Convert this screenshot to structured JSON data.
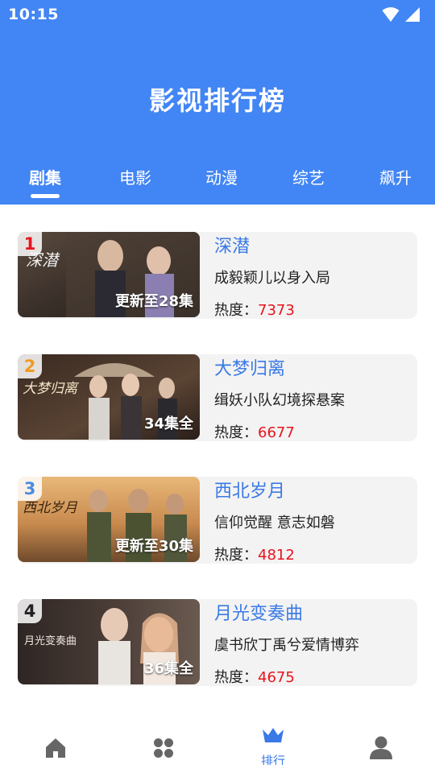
{
  "status_bar": {
    "time": "10:15"
  },
  "header": {
    "title": "影视排行榜"
  },
  "tabs": [
    {
      "label": "剧集",
      "active": true
    },
    {
      "label": "电影",
      "active": false
    },
    {
      "label": "动漫",
      "active": false
    },
    {
      "label": "综艺",
      "active": false
    },
    {
      "label": "飙升",
      "active": false
    }
  ],
  "items": [
    {
      "rank": "1",
      "rank_color": "#e8141c",
      "title": "深潜",
      "thumb_text": "深潜",
      "episodes": "更新至28集",
      "desc": "成毅颖儿以身入局",
      "heat_label": "热度：",
      "heat_value": "7373"
    },
    {
      "rank": "2",
      "rank_color": "#f29a1e",
      "title": "大梦归离",
      "thumb_text": "大梦归离",
      "episodes": "34集全",
      "desc": "缉妖小队幻境探悬案",
      "heat_label": "热度：",
      "heat_value": "6677"
    },
    {
      "rank": "3",
      "rank_color": "#4a8be0",
      "title": "西北岁月",
      "thumb_text": "西北岁月",
      "episodes": "更新至30集",
      "desc": "信仰觉醒 意志如磐",
      "heat_label": "热度：",
      "heat_value": "4812"
    },
    {
      "rank": "4",
      "rank_color": "#222222",
      "title": "月光变奏曲",
      "thumb_text": "月光变奏曲",
      "episodes": "36集全",
      "desc": "虞书欣丁禹兮爱情博弈",
      "heat_label": "热度：",
      "heat_value": "4675"
    }
  ],
  "bottom_nav": [
    {
      "icon": "home-icon",
      "label": ""
    },
    {
      "icon": "grid-icon",
      "label": ""
    },
    {
      "icon": "crown-icon",
      "label": "排行",
      "active": true
    },
    {
      "icon": "user-icon",
      "label": ""
    }
  ],
  "colors": {
    "primary": "#4285f4",
    "accent_text": "#3a79e6",
    "heat": "#e8141c"
  }
}
